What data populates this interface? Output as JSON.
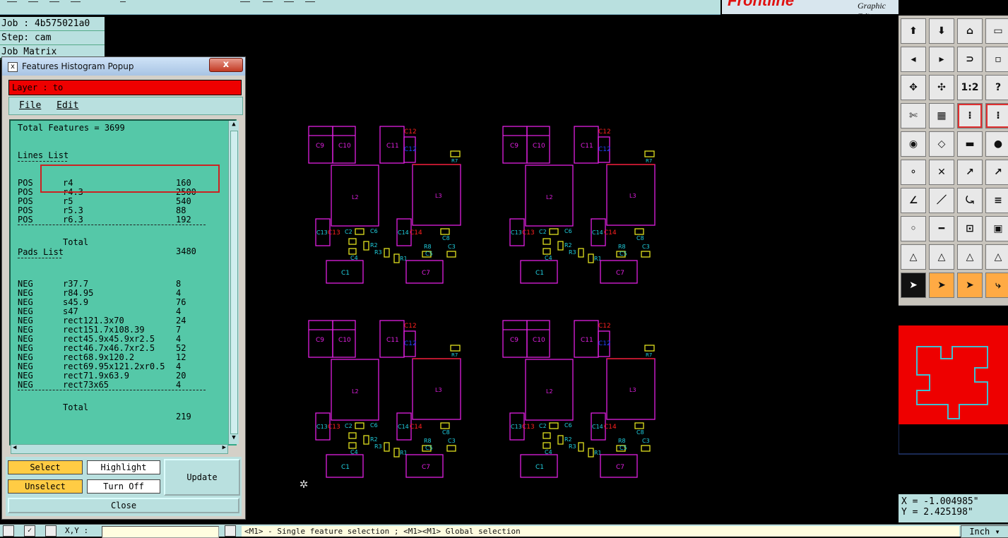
{
  "top_brand": {
    "logo": "Frontline",
    "subtitle": "Graphic Editor"
  },
  "job_info": {
    "job": "Job : 4b575021a0",
    "step": "Step: cam",
    "matrix": "Job Matrix"
  },
  "popup": {
    "title": "Features Histogram Popup",
    "close_x": "x",
    "layer": "Layer :  to",
    "menu": {
      "file": "File",
      "edit": "Edit"
    },
    "total_features": "Total Features = 3699",
    "lines_heading": "Lines List",
    "lines": [
      {
        "pol": "POS",
        "sym": "r4",
        "count": "160"
      },
      {
        "pol": "POS",
        "sym": "r4.3",
        "count": "2500"
      },
      {
        "pol": "POS",
        "sym": "r5",
        "count": "540"
      },
      {
        "pol": "POS",
        "sym": "r5.3",
        "count": "88"
      },
      {
        "pol": "POS",
        "sym": "r6.3",
        "count": "192"
      }
    ],
    "lines_total_label": "Total",
    "lines_total": "3480",
    "pads_heading": "Pads List",
    "pads": [
      {
        "pol": "NEG",
        "sym": "r37.7",
        "count": "8"
      },
      {
        "pol": "NEG",
        "sym": "r84.95",
        "count": "4"
      },
      {
        "pol": "NEG",
        "sym": "s45.9",
        "count": "76"
      },
      {
        "pol": "NEG",
        "sym": "s47",
        "count": "4"
      },
      {
        "pol": "NEG",
        "sym": "rect121.3x70",
        "count": "24"
      },
      {
        "pol": "NEG",
        "sym": "rect151.7x108.39",
        "count": "7"
      },
      {
        "pol": "NEG",
        "sym": "rect45.9x45.9xr2.5",
        "count": "4"
      },
      {
        "pol": "NEG",
        "sym": "rect46.7x46.7xr2.5",
        "count": "52"
      },
      {
        "pol": "NEG",
        "sym": "rect68.9x120.2",
        "count": "12"
      },
      {
        "pol": "NEG",
        "sym": "rect69.95x121.2xr0.5",
        "count": "4"
      },
      {
        "pol": "NEG",
        "sym": "rect71.9x63.9",
        "count": "20"
      },
      {
        "pol": "NEG",
        "sym": "rect73x65",
        "count": "4"
      }
    ],
    "pads_total_label": "Total",
    "pads_total": "219",
    "buttons": {
      "select": "Select",
      "highlight": "Highlight",
      "update": "Update",
      "unselect": "Unselect",
      "turn_off": "Turn Off",
      "close": "Close"
    }
  },
  "pcb": {
    "labels": {
      "c9": "C9",
      "c10": "C10",
      "c11": "C11",
      "c12": "C12",
      "r7": "R7",
      "l2": "L2",
      "l3": "L3",
      "c13": "C13",
      "c14": "C14",
      "c2": "C2",
      "c6": "C6",
      "c8": "C8",
      "r2": "R2",
      "c4": "C4",
      "r3": "R3",
      "r1": "R1",
      "r8": "R8",
      "c3": "C3",
      "c5": "C5",
      "c1": "C1",
      "c7": "C7"
    },
    "colors": {
      "outline": "#e020e0",
      "cyan": "#20d0e0",
      "yellow": "#e0e020",
      "red": "#ff2020",
      "blue": "#2040ff"
    }
  },
  "coords": {
    "x": "X = -1.004985\"",
    "y": "Y =  2.425198\""
  },
  "status": {
    "xy_label": "X,Y :",
    "message": "<M1> - Single feature selection ; <M1><M1> Global selection",
    "units": "Inch"
  }
}
